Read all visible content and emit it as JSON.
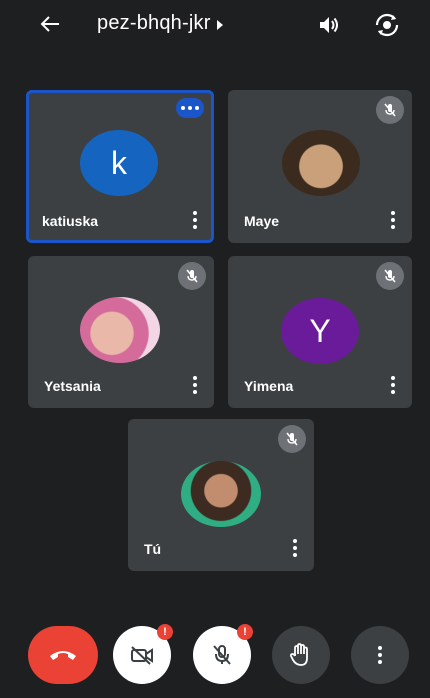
{
  "header": {
    "meeting_code": "pez-bhqh-jkr",
    "icons": [
      "back-arrow-icon",
      "speaker-icon",
      "switch-camera-icon"
    ]
  },
  "participants": [
    {
      "name": "katiuska",
      "avatar_letter": "k",
      "avatar_color": "#1565c0",
      "status": "speaking"
    },
    {
      "name": "Maye",
      "avatar": "photo",
      "status": "muted"
    },
    {
      "name": "Yetsania",
      "avatar": "photo",
      "status": "muted"
    },
    {
      "name": "Yimena",
      "avatar_letter": "Y",
      "avatar_color": "#6a1b9a",
      "status": "muted"
    },
    {
      "name": "Tú",
      "avatar": "photo",
      "status": "muted"
    }
  ],
  "controls": {
    "end_call_color": "#ea4335",
    "video_badge": "!",
    "mic_badge": "!"
  },
  "colors": {
    "background": "#1e1f21",
    "tile": "#3c4043",
    "active_border": "#1a56c9"
  }
}
